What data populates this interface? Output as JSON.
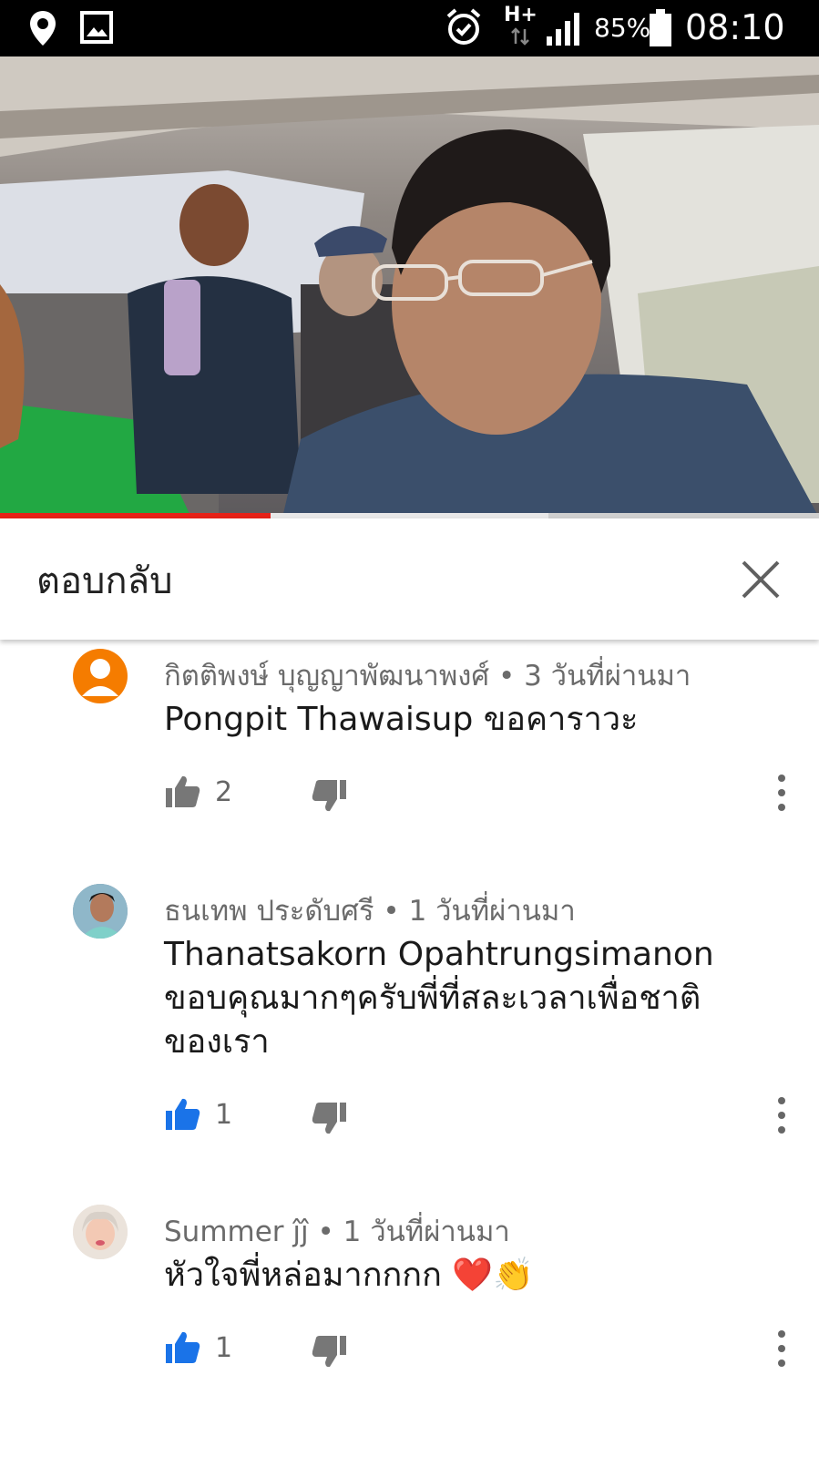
{
  "status_bar": {
    "network": "H+",
    "battery": "85%",
    "time": "08:10",
    "icons": [
      "location-icon",
      "gallery-icon",
      "alarm-icon",
      "network-icon",
      "signal-icon",
      "battery-icon"
    ]
  },
  "video": {
    "progress": 0.33,
    "buffered": 0.67
  },
  "header": {
    "title": "ตอบกลับ"
  },
  "colors": {
    "accent_like": "#1a73e8",
    "progress": "#e62117",
    "avatar_default": "#f57c00"
  },
  "comments": [
    {
      "author": "กิตติพงษ์ บุญญาพัฒนาพงศ์",
      "time": "3 วันที่ผ่านมา",
      "text": "Pongpit Thawaisup ขอคาราวะ",
      "likes": "2",
      "liked": false
    },
    {
      "author": "ธนเทพ ประดับศรี",
      "time": "1 วันที่ผ่านมา",
      "text": "Thanatsakorn Opahtrungsimanon ขอบคุณมากๆครับพี่ที่สละเวลาเพื่อชาติของเรา",
      "likes": "1",
      "liked": true
    },
    {
      "author": "Summer ĵĵ",
      "time": "1 วันที่ผ่านมา",
      "text": "หัวใจพี่หล่อมากกกก ❤️👏",
      "likes": "1",
      "liked": true
    }
  ]
}
